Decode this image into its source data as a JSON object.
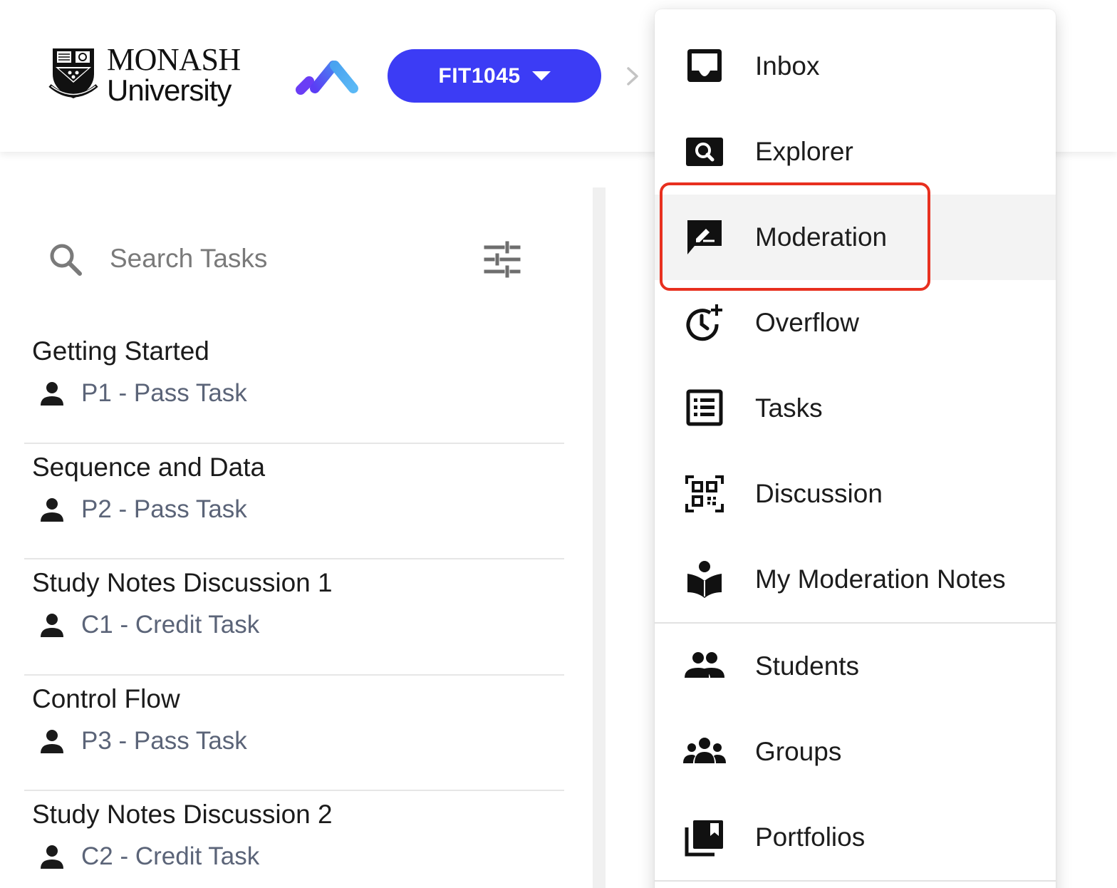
{
  "header": {
    "logo_line1": "MONASH",
    "logo_line2": "University",
    "unit_code": "FIT1045",
    "brand_color": "#3c3cf5"
  },
  "search": {
    "placeholder": "Search Tasks"
  },
  "tasks": [
    {
      "title": "Getting Started",
      "grade": "P1 - Pass Task"
    },
    {
      "title": "Sequence and Data",
      "grade": "P2 - Pass Task"
    },
    {
      "title": "Study Notes Discussion 1",
      "grade": "C1 - Credit Task"
    },
    {
      "title": "Control Flow",
      "grade": "P3 - Pass Task"
    },
    {
      "title": "Study Notes Discussion 2",
      "grade": "C2 - Credit Task"
    }
  ],
  "menu": {
    "items": [
      {
        "label": "Inbox",
        "icon": "inbox-icon"
      },
      {
        "label": "Explorer",
        "icon": "image-search-icon"
      },
      {
        "label": "Moderation",
        "icon": "rate-review-icon",
        "active": true
      },
      {
        "label": "Overflow",
        "icon": "more-time-icon"
      },
      {
        "label": "Tasks",
        "icon": "list-alt-icon"
      },
      {
        "label": "Discussion",
        "icon": "qr-code-scanner-icon"
      },
      {
        "label": "My Moderation Notes",
        "icon": "local-library-icon"
      },
      {
        "label": "Students",
        "icon": "people-icon"
      },
      {
        "label": "Groups",
        "icon": "groups-icon"
      },
      {
        "label": "Portfolios",
        "icon": "collections-bookmark-icon"
      }
    ],
    "highlight_color": "#e8301f"
  }
}
